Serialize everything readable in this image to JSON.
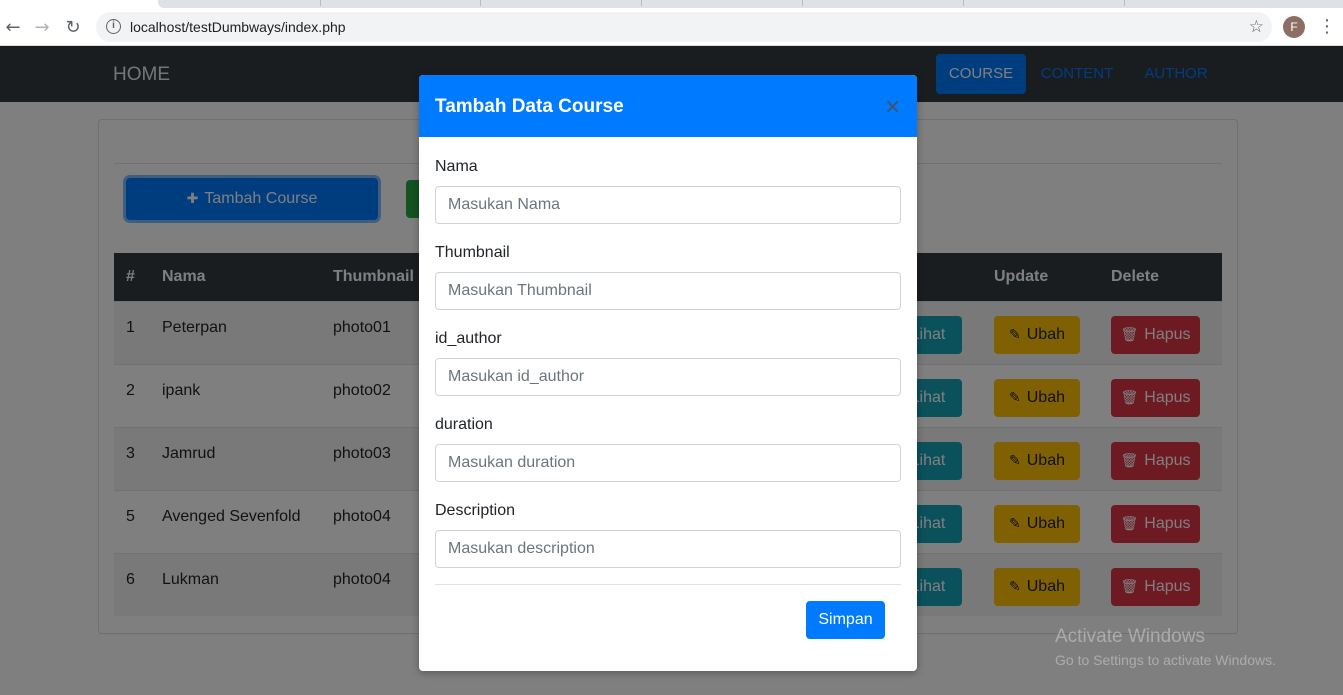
{
  "browser": {
    "url": "localhost/testDumbways/index.php",
    "profile_initial": "F"
  },
  "navbar": {
    "brand": "HOME",
    "items": [
      {
        "label": "COURSE",
        "active": true
      },
      {
        "label": "CONTENT",
        "active": false
      },
      {
        "label": "AUTHOR",
        "active": false
      }
    ]
  },
  "toolbar": {
    "add_label": "Tambah Course"
  },
  "table": {
    "headers": {
      "num": "#",
      "nama": "Nama",
      "thumbnail": "Thumbnail",
      "update": "Update",
      "delete": "Delete"
    },
    "rows": [
      {
        "num": "1",
        "nama": "Peterpan",
        "thumbnail": "photo01"
      },
      {
        "num": "2",
        "nama": "ipank",
        "thumbnail": "photo02"
      },
      {
        "num": "3",
        "nama": "Jamrud",
        "thumbnail": "photo03"
      },
      {
        "num": "5",
        "nama": "Avenged Sevenfold",
        "thumbnail": "photo04"
      },
      {
        "num": "6",
        "nama": "Lukman",
        "thumbnail": "photo04"
      }
    ],
    "actions": {
      "view": "Lihat",
      "edit": "Ubah",
      "delete": "Hapus"
    }
  },
  "modal": {
    "title": "Tambah Data Course",
    "close": "×",
    "fields": [
      {
        "label": "Nama",
        "placeholder": "Masukan Nama",
        "value": ""
      },
      {
        "label": "Thumbnail",
        "placeholder": "Masukan Thumbnail",
        "value": ""
      },
      {
        "label": "id_author",
        "placeholder": "Masukan id_author",
        "value": ""
      },
      {
        "label": "duration",
        "placeholder": "Masukan duration",
        "value": ""
      },
      {
        "label": "Description",
        "placeholder": "Masukan description",
        "value": ""
      }
    ],
    "submit": "Simpan"
  },
  "watermark": {
    "line1": "Activate Windows",
    "line2": "Go to Settings to activate Windows."
  },
  "colors": {
    "primary": "#007bff",
    "dark": "#343a40",
    "info": "#17a2b8",
    "warning": "#ffc107",
    "danger": "#dc3545",
    "success": "#28a745"
  }
}
